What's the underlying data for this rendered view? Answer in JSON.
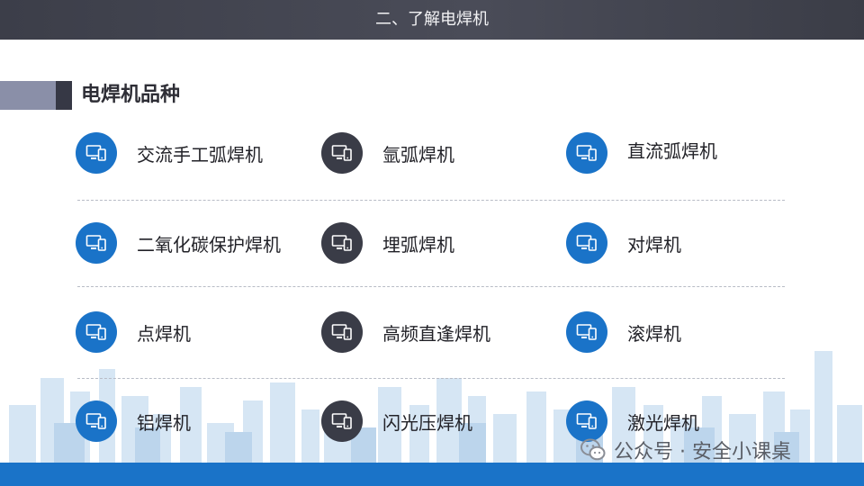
{
  "header": {
    "title": "二、了解电焊机"
  },
  "section": {
    "title": "电焊机品种"
  },
  "items": [
    {
      "label": "交流手工弧焊机",
      "icon": "monitor-phone-icon",
      "color": "blue"
    },
    {
      "label": "氩弧焊机",
      "icon": "monitor-phone-icon",
      "color": "dark"
    },
    {
      "label": "直流弧焊机",
      "icon": "monitor-phone-icon",
      "color": "blue"
    },
    {
      "label": "二氧化碳保护焊机",
      "icon": "monitor-phone-icon",
      "color": "blue"
    },
    {
      "label": "埋弧焊机",
      "icon": "monitor-phone-icon",
      "color": "dark"
    },
    {
      "label": "对焊机",
      "icon": "monitor-phone-icon",
      "color": "blue"
    },
    {
      "label": "点焊机",
      "icon": "monitor-phone-icon",
      "color": "blue"
    },
    {
      "label": "高频直逢焊机",
      "icon": "monitor-phone-icon",
      "color": "dark"
    },
    {
      "label": "滚焊机",
      "icon": "monitor-phone-icon",
      "color": "blue"
    },
    {
      "label": "铝焊机",
      "icon": "monitor-phone-icon",
      "color": "blue"
    },
    {
      "label": "闪光压焊机",
      "icon": "monitor-phone-icon",
      "color": "dark"
    },
    {
      "label": "激光焊机",
      "icon": "monitor-phone-icon",
      "color": "blue"
    }
  ],
  "watermark": {
    "text": "公众号 · 安全小课桌"
  },
  "colors": {
    "blue": "#1a73c8",
    "dark": "#3a3c47",
    "header": "#3c3e49"
  }
}
